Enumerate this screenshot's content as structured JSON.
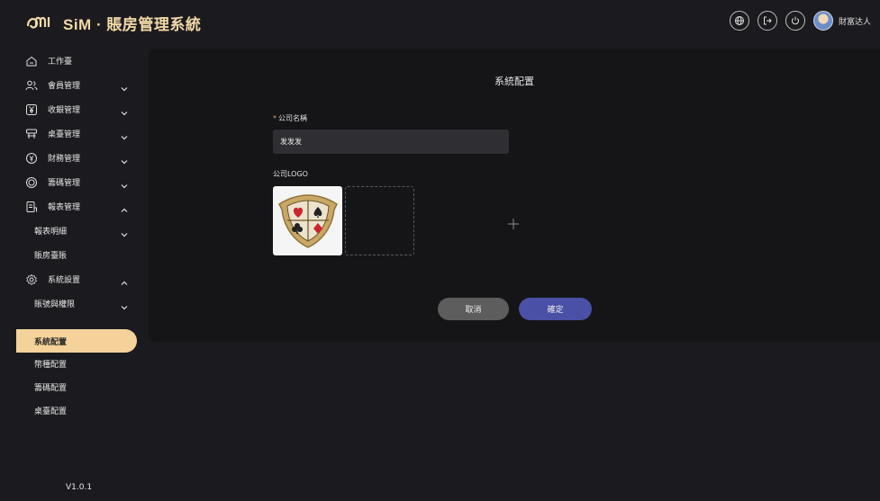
{
  "header": {
    "brand": "SiM · 賬房管理系統",
    "user_name": "財富达人",
    "icons": [
      "globe-icon",
      "logout-icon",
      "power-icon"
    ]
  },
  "sidebar": {
    "items": [
      {
        "label": "工作臺",
        "icon": "home-icon"
      },
      {
        "label": "會員管理",
        "icon": "users-icon",
        "chevron": "down"
      },
      {
        "label": "收銀管理",
        "icon": "yen-icon",
        "chevron": "down"
      },
      {
        "label": "桌臺管理",
        "icon": "table-icon",
        "chevron": "down"
      },
      {
        "label": "財務管理",
        "icon": "currency-icon",
        "chevron": "down"
      },
      {
        "label": "籌碼管理",
        "icon": "chip-icon",
        "chevron": "down"
      },
      {
        "label": "報表管理",
        "icon": "report-icon",
        "chevron": "up"
      },
      {
        "label": "報表明細",
        "chevron": "down"
      },
      {
        "label": "賬房臺賬"
      },
      {
        "label": "系統設置",
        "icon": "settings-icon",
        "chevron": "up"
      },
      {
        "label": "賬號與權限",
        "chevron": "down"
      },
      {
        "label": "系統配置",
        "active": true
      },
      {
        "label": "幣種配置"
      },
      {
        "label": "籌碼配置"
      },
      {
        "label": "桌臺配置"
      }
    ],
    "version": "V1.0.1"
  },
  "main": {
    "title": "系統配置",
    "company_name_label": "公司名稱",
    "company_name_value": "发发发",
    "logo_label": "公司LOGO",
    "cancel_label": "取消",
    "confirm_label": "確定"
  },
  "colors": {
    "accent": "#f5d29a",
    "confirm": "#4a50a6",
    "cancel": "#5d5d5d",
    "panel": "#151518",
    "background": "#1b1b1f"
  }
}
